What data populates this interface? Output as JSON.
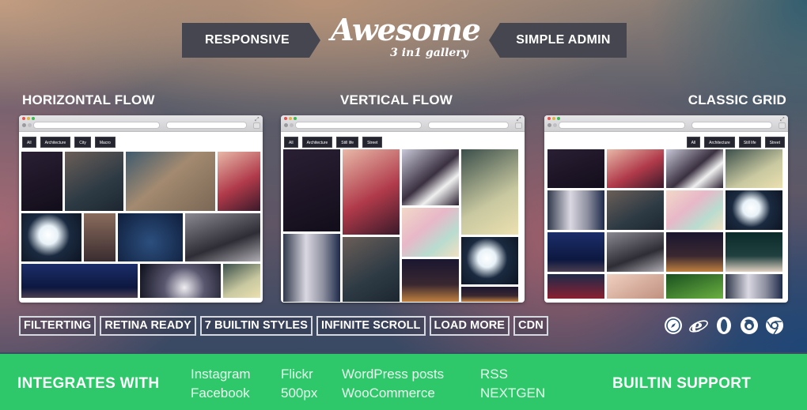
{
  "header": {
    "left_banner": "RESPONSIVE",
    "right_banner": "SIMPLE ADMIN",
    "logo_title": "Awesome",
    "logo_subtitle": "3 in1 gallery"
  },
  "sections": [
    {
      "title": "HORIZONTAL FLOW",
      "filters": [
        "All",
        "Architecture",
        "City",
        "Macro"
      ]
    },
    {
      "title": "VERTICAL FLOW",
      "filters": [
        "All",
        "Architecture",
        "Still life",
        "Street"
      ]
    },
    {
      "title": "CLASSIC GRID",
      "filters": [
        "All",
        "Architecture",
        "Still life",
        "Street"
      ]
    }
  ],
  "features": [
    "FILTERTING",
    "RETINA READY",
    "7 BUILTIN STYLES",
    "INFINITE SCROLL",
    "LOAD MORE",
    "CDN"
  ],
  "browser_support_icons": [
    "safari-icon",
    "internet-explorer-icon",
    "opera-icon",
    "firefox-icon",
    "chrome-icon"
  ],
  "footer": {
    "left_title": "INTEGRATES WITH",
    "right_title": "BUILTIN SUPPORT",
    "integrations": [
      [
        "Instagram",
        "Facebook"
      ],
      [
        "Flickr",
        "500px"
      ],
      [
        "WordPress posts",
        "WooCommerce"
      ],
      [
        "RSS",
        "NEXTGEN"
      ]
    ]
  },
  "colors": {
    "banner": "#45464f",
    "green_bar": "#2ec76a",
    "filter_button": "#252530",
    "dot_red": "#e5534b",
    "dot_yellow": "#e3b341",
    "dot_green": "#3fb950"
  }
}
